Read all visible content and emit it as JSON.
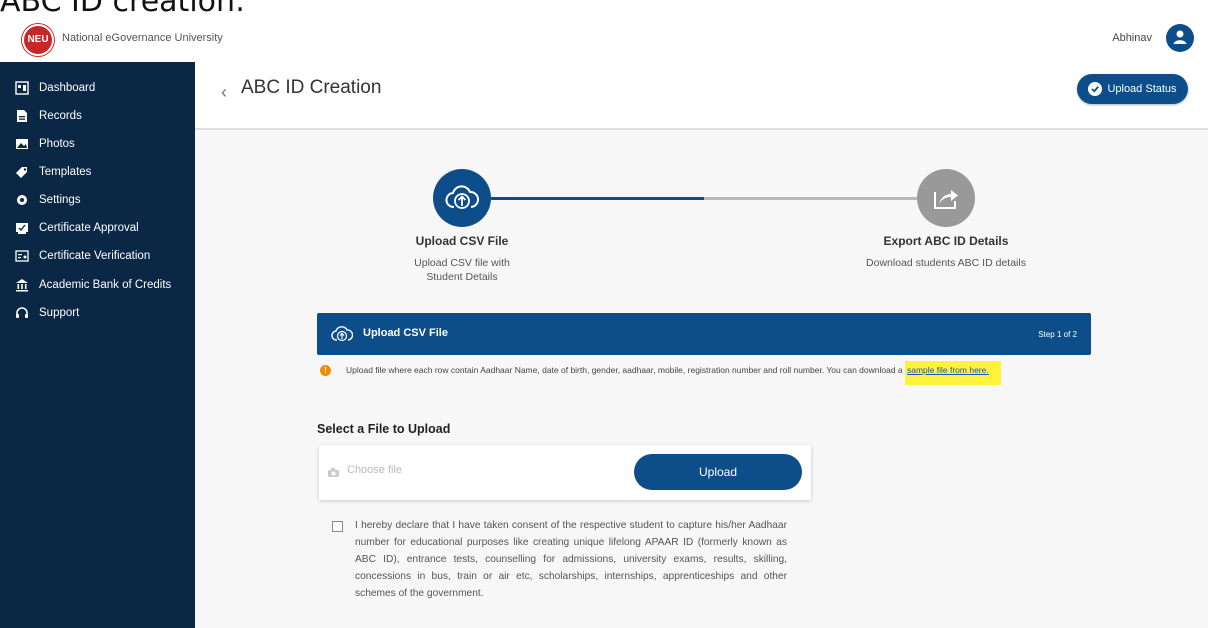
{
  "cut_caption": "ABC ID creation:",
  "header": {
    "brand": "National eGovernance University",
    "logo_text": "NEU",
    "user_name": "Abhinav"
  },
  "sidebar": {
    "items": [
      {
        "label": "Dashboard",
        "icon": "dashboard-icon"
      },
      {
        "label": "Records",
        "icon": "records-icon"
      },
      {
        "label": "Photos",
        "icon": "photos-icon"
      },
      {
        "label": "Templates",
        "icon": "templates-icon"
      },
      {
        "label": "Settings",
        "icon": "settings-icon"
      },
      {
        "label": "Certificate Approval",
        "icon": "certificate-approval-icon"
      },
      {
        "label": "Certificate Verification",
        "icon": "certificate-verification-icon"
      },
      {
        "label": "Academic Bank of Credits",
        "icon": "bank-icon"
      },
      {
        "label": "Support",
        "icon": "headset-icon"
      }
    ]
  },
  "page": {
    "title": "ABC ID Creation",
    "upload_status_label": "Upload Status"
  },
  "stepper": {
    "steps": [
      {
        "title": "Upload CSV File",
        "desc_line1": "Upload CSV file with",
        "desc_line2": "Student Details",
        "state": "active"
      },
      {
        "title": "Export ABC ID Details",
        "desc_line1": "Download students ABC ID details",
        "desc_line2": "",
        "state": "inactive"
      }
    ]
  },
  "upload_panel": {
    "title": "Upload CSV File",
    "step_text": "Step 1 of 2",
    "info_text": "Upload file where each row contain Aadhaar Name, date of birth, gender, aadhaar, mobile, registration number and roll number. You can download a ",
    "sample_link": "sample file from here."
  },
  "file_select": {
    "label": "Select a File to Upload",
    "placeholder": "Choose file",
    "upload_button": "Upload"
  },
  "declaration": {
    "text": "I hereby declare that I have taken consent of the respective student to capture his/her Aadhaar number for educational purposes like creating unique lifelong APAAR ID (formerly known as ABC ID), entrance tests, counselling for admissions, university exams, results, skilling, concessions in bus, train or air etc, scholarships, internships, apprenticeships and other schemes of the government.",
    "checked": false
  },
  "colors": {
    "primary": "#0d4d8a",
    "sidebar_bg": "#0a2746",
    "highlight": "#fff23a",
    "info_orange": "#f08c00"
  }
}
